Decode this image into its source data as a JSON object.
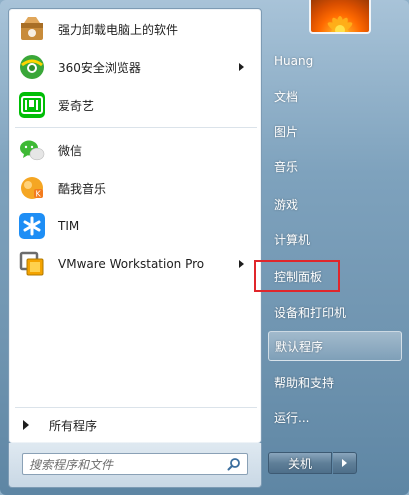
{
  "programs": [
    {
      "label": "强力卸载电脑上的软件",
      "icon": "uninstaller-box-icon",
      "has_submenu": false
    },
    {
      "label": "360安全浏览器",
      "icon": "360-browser-icon",
      "has_submenu": true
    },
    {
      "label": "爱奇艺",
      "icon": "iqiyi-icon",
      "has_submenu": false
    },
    {
      "label": "微信",
      "icon": "wechat-icon",
      "has_submenu": false
    },
    {
      "label": "酷我音乐",
      "icon": "kuwo-music-icon",
      "has_submenu": false
    },
    {
      "label": "TIM",
      "icon": "tim-icon",
      "has_submenu": false
    },
    {
      "label": "VMware Workstation Pro",
      "icon": "vmware-icon",
      "has_submenu": true
    }
  ],
  "all_programs_label": "所有程序",
  "search": {
    "placeholder": "搜索程序和文件"
  },
  "right_items": [
    {
      "label": "Huang"
    },
    {
      "label": "文档"
    },
    {
      "label": "图片"
    },
    {
      "label": "音乐"
    },
    {
      "label": "游戏"
    },
    {
      "label": "计算机"
    },
    {
      "label": "控制面板"
    },
    {
      "label": "设备和打印机"
    },
    {
      "label": "默认程序"
    },
    {
      "label": "帮助和支持"
    },
    {
      "label": "运行..."
    }
  ],
  "shutdown_label": "关机",
  "colors": {
    "highlight_box": "#e0262b",
    "panel_white": "#ffffff",
    "right_text": "#ffffff"
  }
}
